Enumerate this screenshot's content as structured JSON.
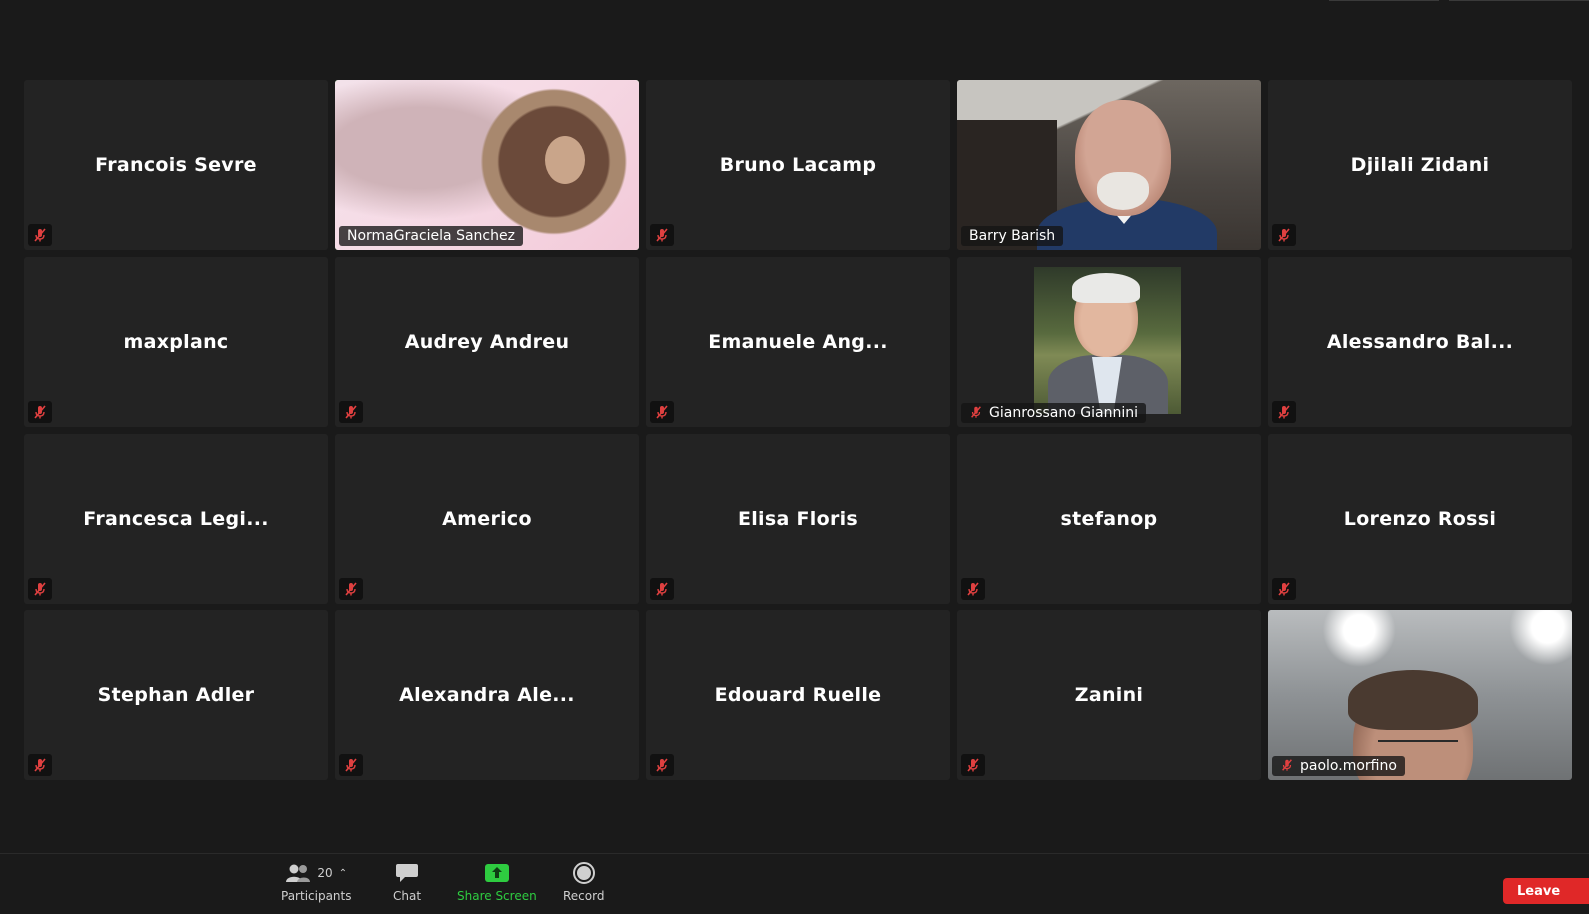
{
  "participants": [
    {
      "name": "Francois Sevre",
      "display": "Francois Sevre",
      "video": false,
      "muted": true
    },
    {
      "name": "NormaGraciela Sanchez",
      "display": "NormaGraciela Sanchez",
      "video": true,
      "muted": false,
      "active_speaker": true
    },
    {
      "name": "Bruno Lacamp",
      "display": "Bruno Lacamp",
      "video": false,
      "muted": true
    },
    {
      "name": "Barry Barish",
      "display": "Barry Barish",
      "video": true,
      "muted": false
    },
    {
      "name": "Djilali Zidani",
      "display": "Djilali Zidani",
      "video": false,
      "muted": true
    },
    {
      "name": "maxplanc",
      "display": "maxplanc",
      "video": false,
      "muted": true
    },
    {
      "name": "Audrey Andreu",
      "display": "Audrey Andreu",
      "video": false,
      "muted": true
    },
    {
      "name": "Emanuele Ang...",
      "display": "Emanuele Ang...",
      "video": false,
      "muted": true
    },
    {
      "name": "Gianrossano Giannini",
      "display": "Gianrossano Giannini",
      "video": true,
      "muted": true
    },
    {
      "name": "Alessandro Bal...",
      "display": "Alessandro Bal...",
      "video": false,
      "muted": true
    },
    {
      "name": "Francesca Legi...",
      "display": "Francesca Legi...",
      "video": false,
      "muted": true
    },
    {
      "name": "Americo",
      "display": "Americo",
      "video": false,
      "muted": true
    },
    {
      "name": "Elisa Floris",
      "display": "Elisa Floris",
      "video": false,
      "muted": true
    },
    {
      "name": "stefanop",
      "display": "stefanop",
      "video": false,
      "muted": true
    },
    {
      "name": "Lorenzo Rossi",
      "display": "Lorenzo Rossi",
      "video": false,
      "muted": true
    },
    {
      "name": "Stephan Adler",
      "display": "Stephan Adler",
      "video": false,
      "muted": true
    },
    {
      "name": "Alexandra Ale...",
      "display": "Alexandra Ale...",
      "video": false,
      "muted": true
    },
    {
      "name": "Edouard Ruelle",
      "display": "Edouard Ruelle",
      "video": false,
      "muted": true
    },
    {
      "name": "Zanini",
      "display": "Zanini",
      "video": false,
      "muted": true
    },
    {
      "name": "paolo.morfino",
      "display": "paolo.morfino",
      "video": true,
      "muted": true
    }
  ],
  "toolbar": {
    "participants_label": "Participants",
    "participants_count": "20",
    "chat_label": "Chat",
    "share_label": "Share Screen",
    "record_label": "Record",
    "leave_label": "Leave"
  },
  "colors": {
    "background": "#1a1a1a",
    "tile": "#232323",
    "active_border": "#2ecc40",
    "muted_icon": "#e04040",
    "leave": "#e02828",
    "share_green": "#2ecc40"
  },
  "icons": {
    "mute": "mic-muted-icon",
    "participants": "people-icon",
    "chat": "chat-bubble-icon",
    "share": "share-screen-icon",
    "record": "record-icon"
  }
}
